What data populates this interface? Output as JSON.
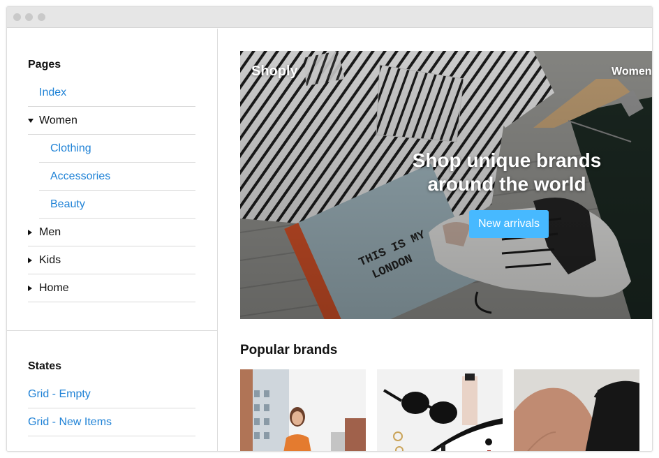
{
  "window": {
    "title_dots": [
      "close",
      "minimize",
      "maximize"
    ]
  },
  "sidebar": {
    "pages_title": "Pages",
    "pages": [
      {
        "label": "Index",
        "style": "link",
        "indent": 1,
        "caret": ""
      },
      {
        "label": "Women",
        "style": "dark",
        "indent": 1,
        "caret": "down"
      },
      {
        "label": "Clothing",
        "style": "link",
        "indent": 2,
        "caret": ""
      },
      {
        "label": "Accessories",
        "style": "link",
        "indent": 2,
        "caret": ""
      },
      {
        "label": "Beauty",
        "style": "link",
        "indent": 2,
        "caret": ""
      },
      {
        "label": "Men",
        "style": "dark",
        "indent": 1,
        "caret": "right"
      },
      {
        "label": "Kids",
        "style": "dark",
        "indent": 1,
        "caret": "right"
      },
      {
        "label": "Home",
        "style": "dark",
        "indent": 1,
        "caret": "right"
      }
    ],
    "states_title": "States",
    "states": [
      {
        "label": "Grid - Empty"
      },
      {
        "label": "Grid - New Items"
      }
    ]
  },
  "hero": {
    "brand": "Shoply",
    "nav_item": "Women",
    "headline": "Shop unique brands around the world",
    "cta": "New arrivals",
    "notebook_text": "THIS IS MY LONDON"
  },
  "popular_brands": {
    "title": "Popular brands",
    "cards": [
      "brand-card-1",
      "brand-card-2",
      "brand-card-3"
    ]
  },
  "colors": {
    "link": "#1f82d6",
    "cta": "#47b9ff",
    "divider": "#d9d9d9"
  }
}
